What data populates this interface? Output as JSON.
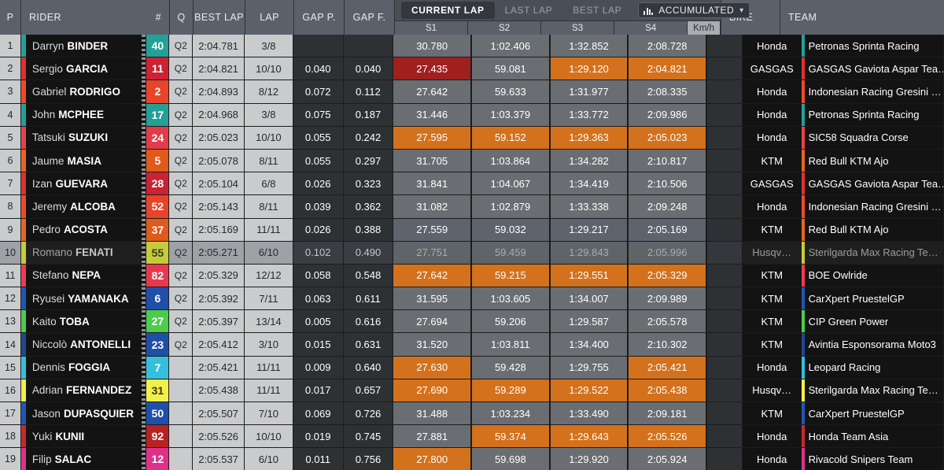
{
  "header": {
    "columns": {
      "pos": "P",
      "rider": "RIDER",
      "number": "#",
      "q": "Q",
      "best_lap": "BEST LAP",
      "lap": "LAP",
      "gap_p": "GAP P.",
      "gap_f": "GAP F.",
      "bike": "BIKE",
      "team": "TEAM"
    },
    "tabs": [
      {
        "label": "CURRENT LAP",
        "active": true
      },
      {
        "label": "LAST LAP",
        "active": false
      },
      {
        "label": "BEST LAP",
        "active": false
      }
    ],
    "mode_select": {
      "icon": "bar-chart-icon",
      "value": "ACCUMULATED",
      "caret": "⌄"
    },
    "sector_labels": [
      "S1",
      "S2",
      "S3",
      "S4"
    ],
    "speed_label": "Km/h"
  },
  "colors": {
    "orange": "#d4711c",
    "dark_red": "#a02020",
    "header_bg": "#5b616b",
    "row_bg": "#131313",
    "light_cell": "#c9cbcd"
  },
  "rows": [
    {
      "pos": "1",
      "first": "Darryn",
      "last": "BINDER",
      "num": "40",
      "num_bg": "#23a098",
      "num_color": "#ffffff",
      "stripe": "#23a098",
      "q": "Q2",
      "best_lap": "2:04.781",
      "lap": "3/8",
      "gap_p": "",
      "gap_f": "",
      "s1": "30.780",
      "s2": "1:02.406",
      "s3": "1:32.852",
      "s4": "2:08.728",
      "s1_tone": "",
      "s2_tone": "",
      "s3_tone": "",
      "s4_tone": "",
      "kmh": "",
      "bike": "Honda",
      "team": "Petronas Sprinta Racing",
      "team_stripe": "#23a098",
      "highlight": false
    },
    {
      "pos": "2",
      "first": "Sergio",
      "last": "GARCIA",
      "num": "11",
      "num_bg": "#cc2233",
      "num_color": "#ffffff",
      "stripe": "#e03030",
      "q": "Q2",
      "best_lap": "2:04.821",
      "lap": "10/10",
      "gap_p": "0.040",
      "gap_f": "0.040",
      "s1": "27.435",
      "s2": "59.081",
      "s3": "1:29.120",
      "s4": "2:04.821",
      "s1_tone": "tone-darkred",
      "s2_tone": "",
      "s3_tone": "tone-orange",
      "s4_tone": "tone-orange",
      "kmh": "",
      "bike": "GASGAS",
      "team": "GASGAS Gaviota Aspar Tea…",
      "team_stripe": "#e03030",
      "highlight": false
    },
    {
      "pos": "3",
      "first": "Gabriel",
      "last": "RODRIGO",
      "num": "2",
      "num_bg": "#e8442a",
      "num_color": "#ffffff",
      "stripe": "#ef4b27",
      "q": "Q2",
      "best_lap": "2:04.893",
      "lap": "8/12",
      "gap_p": "0.072",
      "gap_f": "0.112",
      "s1": "27.642",
      "s2": "59.633",
      "s3": "1:31.977",
      "s4": "2:08.335",
      "s1_tone": "",
      "s2_tone": "",
      "s3_tone": "",
      "s4_tone": "",
      "kmh": "",
      "bike": "Honda",
      "team": "Indonesian Racing Gresini …",
      "team_stripe": "#ef4b27",
      "highlight": false
    },
    {
      "pos": "4",
      "first": "John",
      "last": "MCPHEE",
      "num": "17",
      "num_bg": "#23a098",
      "num_color": "#ffffff",
      "stripe": "#23a098",
      "q": "Q2",
      "best_lap": "2:04.968",
      "lap": "3/8",
      "gap_p": "0.075",
      "gap_f": "0.187",
      "s1": "31.446",
      "s2": "1:03.379",
      "s3": "1:33.772",
      "s4": "2:09.986",
      "s1_tone": "",
      "s2_tone": "",
      "s3_tone": "",
      "s4_tone": "",
      "kmh": "",
      "bike": "Honda",
      "team": "Petronas Sprinta Racing",
      "team_stripe": "#23a098",
      "highlight": false
    },
    {
      "pos": "5",
      "first": "Tatsuki",
      "last": "SUZUKI",
      "num": "24",
      "num_bg": "#e23b4a",
      "num_color": "#ffffff",
      "stripe": "#e8414e",
      "q": "Q2",
      "best_lap": "2:05.023",
      "lap": "10/10",
      "gap_p": "0.055",
      "gap_f": "0.242",
      "s1": "27.595",
      "s2": "59.152",
      "s3": "1:29.363",
      "s4": "2:05.023",
      "s1_tone": "tone-orange",
      "s2_tone": "tone-orange",
      "s3_tone": "tone-orange",
      "s4_tone": "tone-orange",
      "kmh": "",
      "bike": "Honda",
      "team": "SIC58 Squadra Corse",
      "team_stripe": "#e8414e",
      "highlight": false
    },
    {
      "pos": "6",
      "first": "Jaume",
      "last": "MASIA",
      "num": "5",
      "num_bg": "#e05a1c",
      "num_color": "#ffffff",
      "stripe": "#e8641f",
      "q": "Q2",
      "best_lap": "2:05.078",
      "lap": "8/11",
      "gap_p": "0.055",
      "gap_f": "0.297",
      "s1": "31.705",
      "s2": "1:03.864",
      "s3": "1:34.282",
      "s4": "2:10.817",
      "s1_tone": "",
      "s2_tone": "",
      "s3_tone": "",
      "s4_tone": "",
      "kmh": "",
      "bike": "KTM",
      "team": "Red Bull KTM Ajo",
      "team_stripe": "#e8641f",
      "highlight": false
    },
    {
      "pos": "7",
      "first": "Izan",
      "last": "GUEVARA",
      "num": "28",
      "num_bg": "#cc2233",
      "num_color": "#ffffff",
      "stripe": "#e03030",
      "q": "Q2",
      "best_lap": "2:05.104",
      "lap": "6/8",
      "gap_p": "0.026",
      "gap_f": "0.323",
      "s1": "31.841",
      "s2": "1:04.067",
      "s3": "1:34.419",
      "s4": "2:10.506",
      "s1_tone": "",
      "s2_tone": "",
      "s3_tone": "",
      "s4_tone": "",
      "kmh": "",
      "bike": "GASGAS",
      "team": "GASGAS Gaviota Aspar Tea…",
      "team_stripe": "#e03030",
      "highlight": false
    },
    {
      "pos": "8",
      "first": "Jeremy",
      "last": "ALCOBA",
      "num": "52",
      "num_bg": "#e8442a",
      "num_color": "#ffffff",
      "stripe": "#ef4b27",
      "q": "Q2",
      "best_lap": "2:05.143",
      "lap": "8/11",
      "gap_p": "0.039",
      "gap_f": "0.362",
      "s1": "31.082",
      "s2": "1:02.879",
      "s3": "1:33.338",
      "s4": "2:09.248",
      "s1_tone": "",
      "s2_tone": "",
      "s3_tone": "",
      "s4_tone": "",
      "kmh": "",
      "bike": "Honda",
      "team": "Indonesian Racing Gresini …",
      "team_stripe": "#ef4b27",
      "highlight": false
    },
    {
      "pos": "9",
      "first": "Pedro",
      "last": "ACOSTA",
      "num": "37",
      "num_bg": "#e05a1c",
      "num_color": "#ffffff",
      "stripe": "#e8641f",
      "q": "Q2",
      "best_lap": "2:05.169",
      "lap": "11/11",
      "gap_p": "0.026",
      "gap_f": "0.388",
      "s1": "27.559",
      "s2": "59.032",
      "s3": "1:29.217",
      "s4": "2:05.169",
      "s1_tone": "tone-bluegray",
      "s2_tone": "tone-bluegray",
      "s3_tone": "tone-bluegray",
      "s4_tone": "tone-bluegray",
      "kmh": "",
      "bike": "KTM",
      "team": "Red Bull KTM Ajo",
      "team_stripe": "#e8641f",
      "highlight": false
    },
    {
      "pos": "10",
      "first": "Romano",
      "last": "FENATI",
      "num": "55",
      "num_bg": "#c5cc3c",
      "num_color": "#3a3d12",
      "stripe": "#c5cc3c",
      "q": "Q2",
      "best_lap": "2:05.271",
      "lap": "6/10",
      "gap_p": "0.102",
      "gap_f": "0.490",
      "s1": "27.751",
      "s2": "59.459",
      "s3": "1:29.843",
      "s4": "2:05.996",
      "s1_tone": "tone-dim",
      "s2_tone": "tone-dim",
      "s3_tone": "tone-dim",
      "s4_tone": "tone-dim",
      "kmh": "",
      "bike": "Husqv…",
      "team": "Sterilgarda Max Racing Te…",
      "team_stripe": "#c5cc3c",
      "highlight": true
    },
    {
      "pos": "11",
      "first": "Stefano",
      "last": "NEPA",
      "num": "82",
      "num_bg": "#e8384e",
      "num_color": "#ffffff",
      "stripe": "#ef3b52",
      "q": "Q2",
      "best_lap": "2:05.329",
      "lap": "12/12",
      "gap_p": "0.058",
      "gap_f": "0.548",
      "s1": "27.642",
      "s2": "59.215",
      "s3": "1:29.551",
      "s4": "2:05.329",
      "s1_tone": "tone-orange",
      "s2_tone": "tone-orange",
      "s3_tone": "tone-orange",
      "s4_tone": "tone-orange",
      "kmh": "",
      "bike": "KTM",
      "team": "BOE Owlride",
      "team_stripe": "#ef3b52",
      "highlight": false
    },
    {
      "pos": "12",
      "first": "Ryusei",
      "last": "YAMANAKA",
      "num": "6",
      "num_bg": "#1f4fa8",
      "num_color": "#ffffff",
      "stripe": "#2257b4",
      "q": "Q2",
      "best_lap": "2:05.392",
      "lap": "7/11",
      "gap_p": "0.063",
      "gap_f": "0.611",
      "s1": "31.595",
      "s2": "1:03.605",
      "s3": "1:34.007",
      "s4": "2:09.989",
      "s1_tone": "",
      "s2_tone": "",
      "s3_tone": "",
      "s4_tone": "",
      "kmh": "",
      "bike": "KTM",
      "team": "CarXpert PruestelGP",
      "team_stripe": "#2257b4",
      "highlight": false
    },
    {
      "pos": "13",
      "first": "Kaito",
      "last": "TOBA",
      "num": "27",
      "num_bg": "#4ccc4c",
      "num_color": "#ffffff",
      "stripe": "#4ccc4c",
      "q": "Q2",
      "best_lap": "2:05.397",
      "lap": "13/14",
      "gap_p": "0.005",
      "gap_f": "0.616",
      "s1": "27.694",
      "s2": "59.206",
      "s3": "1:29.587",
      "s4": "2:05.578",
      "s1_tone": "",
      "s2_tone": "",
      "s3_tone": "",
      "s4_tone": "",
      "kmh": "",
      "bike": "KTM",
      "team": "CIP Green Power",
      "team_stripe": "#4ccc4c",
      "highlight": false
    },
    {
      "pos": "14",
      "first": "Niccolò",
      "last": "ANTONELLI",
      "num": "23",
      "num_bg": "#1f4fa8",
      "num_color": "#ffffff",
      "stripe": "#23468f",
      "q": "Q2",
      "best_lap": "2:05.412",
      "lap": "3/10",
      "gap_p": "0.015",
      "gap_f": "0.631",
      "s1": "31.520",
      "s2": "1:03.811",
      "s3": "1:34.400",
      "s4": "2:10.302",
      "s1_tone": "",
      "s2_tone": "",
      "s3_tone": "",
      "s4_tone": "",
      "kmh": "",
      "bike": "KTM",
      "team": "Avintia Esponsorama Moto3",
      "team_stripe": "#23468f",
      "highlight": false
    },
    {
      "pos": "15",
      "first": "Dennis",
      "last": "FOGGIA",
      "num": "7",
      "num_bg": "#34c0dd",
      "num_color": "#ffffff",
      "stripe": "#34c0dd",
      "q": "",
      "best_lap": "2:05.421",
      "lap": "11/11",
      "gap_p": "0.009",
      "gap_f": "0.640",
      "s1": "27.630",
      "s2": "59.428",
      "s3": "1:29.755",
      "s4": "2:05.421",
      "s1_tone": "tone-orange",
      "s2_tone": "",
      "s3_tone": "",
      "s4_tone": "tone-orange",
      "kmh": "",
      "bike": "Honda",
      "team": "Leopard Racing",
      "team_stripe": "#34c0dd",
      "highlight": false
    },
    {
      "pos": "16",
      "first": "Adrian",
      "last": "FERNANDEZ",
      "num": "31",
      "num_bg": "#f2ef4a",
      "num_color": "#3a3a10",
      "stripe": "#f2ef4a",
      "q": "",
      "best_lap": "2:05.438",
      "lap": "11/11",
      "gap_p": "0.017",
      "gap_f": "0.657",
      "s1": "27.690",
      "s2": "59.289",
      "s3": "1:29.522",
      "s4": "2:05.438",
      "s1_tone": "tone-orange",
      "s2_tone": "tone-orange",
      "s3_tone": "tone-orange",
      "s4_tone": "tone-orange",
      "kmh": "",
      "bike": "Husqv…",
      "team": "Sterilgarda Max Racing Te…",
      "team_stripe": "#f2ef4a",
      "highlight": false
    },
    {
      "pos": "17",
      "first": "Jason",
      "last": "DUPASQUIER",
      "num": "50",
      "num_bg": "#1f4fa8",
      "num_color": "#ffffff",
      "stripe": "#2257b4",
      "q": "",
      "best_lap": "2:05.507",
      "lap": "7/10",
      "gap_p": "0.069",
      "gap_f": "0.726",
      "s1": "31.488",
      "s2": "1:03.234",
      "s3": "1:33.490",
      "s4": "2:09.181",
      "s1_tone": "",
      "s2_tone": "",
      "s3_tone": "",
      "s4_tone": "",
      "kmh": "",
      "bike": "KTM",
      "team": "CarXpert PruestelGP",
      "team_stripe": "#2257b4",
      "highlight": false
    },
    {
      "pos": "18",
      "first": "Yuki",
      "last": "KUNII",
      "num": "92",
      "num_bg": "#b82222",
      "num_color": "#ffffff",
      "stripe": "#c52a2a",
      "q": "",
      "best_lap": "2:05.526",
      "lap": "10/10",
      "gap_p": "0.019",
      "gap_f": "0.745",
      "s1": "27.881",
      "s2": "59.374",
      "s3": "1:29.643",
      "s4": "2:05.526",
      "s1_tone": "",
      "s2_tone": "tone-orange",
      "s3_tone": "tone-orange",
      "s4_tone": "tone-orange",
      "kmh": "",
      "bike": "Honda",
      "team": "Honda Team Asia",
      "team_stripe": "#c52a2a",
      "highlight": false
    },
    {
      "pos": "19",
      "first": "Filip",
      "last": "SALAC",
      "num": "12",
      "num_bg": "#e0308a",
      "num_color": "#ffffff",
      "stripe": "#e0308a",
      "q": "",
      "best_lap": "2:05.537",
      "lap": "6/10",
      "gap_p": "0.011",
      "gap_f": "0.756",
      "s1": "27.800",
      "s2": "59.698",
      "s3": "1:29.920",
      "s4": "2:05.924",
      "s1_tone": "tone-orange",
      "s2_tone": "",
      "s3_tone": "",
      "s4_tone": "",
      "kmh": "",
      "bike": "Honda",
      "team": "Rivacold Snipers Team",
      "team_stripe": "#e0308a",
      "highlight": false
    }
  ]
}
